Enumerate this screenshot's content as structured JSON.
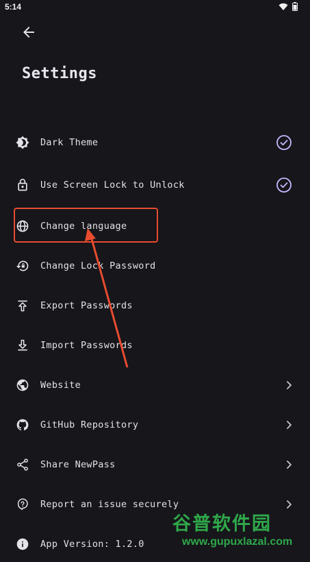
{
  "status_bar": {
    "time": "5:14"
  },
  "header": {
    "title": "Settings"
  },
  "settings": [
    {
      "label": "Dark Theme",
      "icon": "brightness-icon",
      "trailing": "check"
    },
    {
      "label": "Use Screen Lock to Unlock",
      "icon": "lock-icon",
      "trailing": "check"
    },
    {
      "label": "Change language",
      "icon": "globe-icon",
      "trailing": "none"
    },
    {
      "label": "Change Lock Password",
      "icon": "lock-reset-icon",
      "trailing": "none"
    },
    {
      "label": "Export Passwords",
      "icon": "upload-icon",
      "trailing": "none"
    },
    {
      "label": "Import Passwords",
      "icon": "download-icon",
      "trailing": "none"
    },
    {
      "label": "Website",
      "icon": "web-icon",
      "trailing": "chevron"
    },
    {
      "label": "GitHub Repository",
      "icon": "github-icon",
      "trailing": "chevron"
    },
    {
      "label": "Share NewPass",
      "icon": "share-icon",
      "trailing": "chevron"
    },
    {
      "label": "Report an issue securely",
      "icon": "help-icon",
      "trailing": "chevron"
    },
    {
      "label": "App Version: 1.2.0",
      "icon": "info-icon",
      "trailing": "none"
    }
  ],
  "watermark": {
    "text_cn": "谷普软件园",
    "url": "www.gupuxlazal.com"
  },
  "colors": {
    "background": "#16161b",
    "accent": "#c9b8ff",
    "annotation": "#e74c2f",
    "watermark": "#2fa84a"
  }
}
